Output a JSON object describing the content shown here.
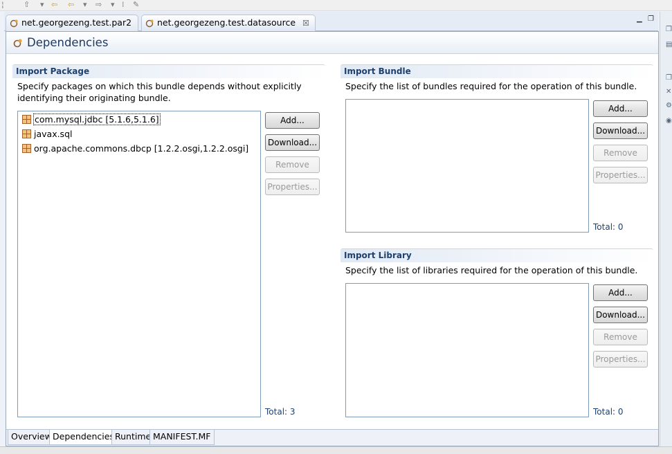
{
  "tabs": [
    {
      "label": "net.georgezeng.test.par2",
      "active": false
    },
    {
      "label": "net.georgezeng.test.datasource",
      "active": true,
      "close_glyph": "☒"
    }
  ],
  "form": {
    "title": "Dependencies"
  },
  "import_package": {
    "title": "Import Package",
    "description_line1": "Specify packages on which this bundle depends without explicitly",
    "description_line2": "identifying their originating bundle.",
    "items": [
      "com.mysql.jdbc [5.1.6,5.1.6]",
      "javax.sql",
      "org.apache.commons.dbcp [1.2.2.osgi,1.2.2.osgi]"
    ],
    "buttons": {
      "add": "Add...",
      "download": "Download...",
      "remove": "Remove",
      "properties": "Properties..."
    },
    "total": "Total: 3"
  },
  "import_bundle": {
    "title": "Import Bundle",
    "description": "Specify the list of bundles required for the operation of this bundle.",
    "buttons": {
      "add": "Add...",
      "download": "Download...",
      "remove": "Remove",
      "properties": "Properties..."
    },
    "total": "Total: 0"
  },
  "import_library": {
    "title": "Import Library",
    "description": "Specify the list of libraries required for the operation of this bundle.",
    "buttons": {
      "add": "Add...",
      "download": "Download...",
      "remove": "Remove",
      "properties": "Properties..."
    },
    "total": "Total: 0"
  },
  "page_tabs": [
    "Overview",
    "Dependencies",
    "Runtime",
    "MANIFEST.MF"
  ],
  "active_page_tab": "Dependencies",
  "colors": {
    "section_title": "#1e416e",
    "form_title": "#1f3a60",
    "list_border": "#7f9db9",
    "editor_background": "#ffffff",
    "chrome_background": "#eef2f8"
  }
}
